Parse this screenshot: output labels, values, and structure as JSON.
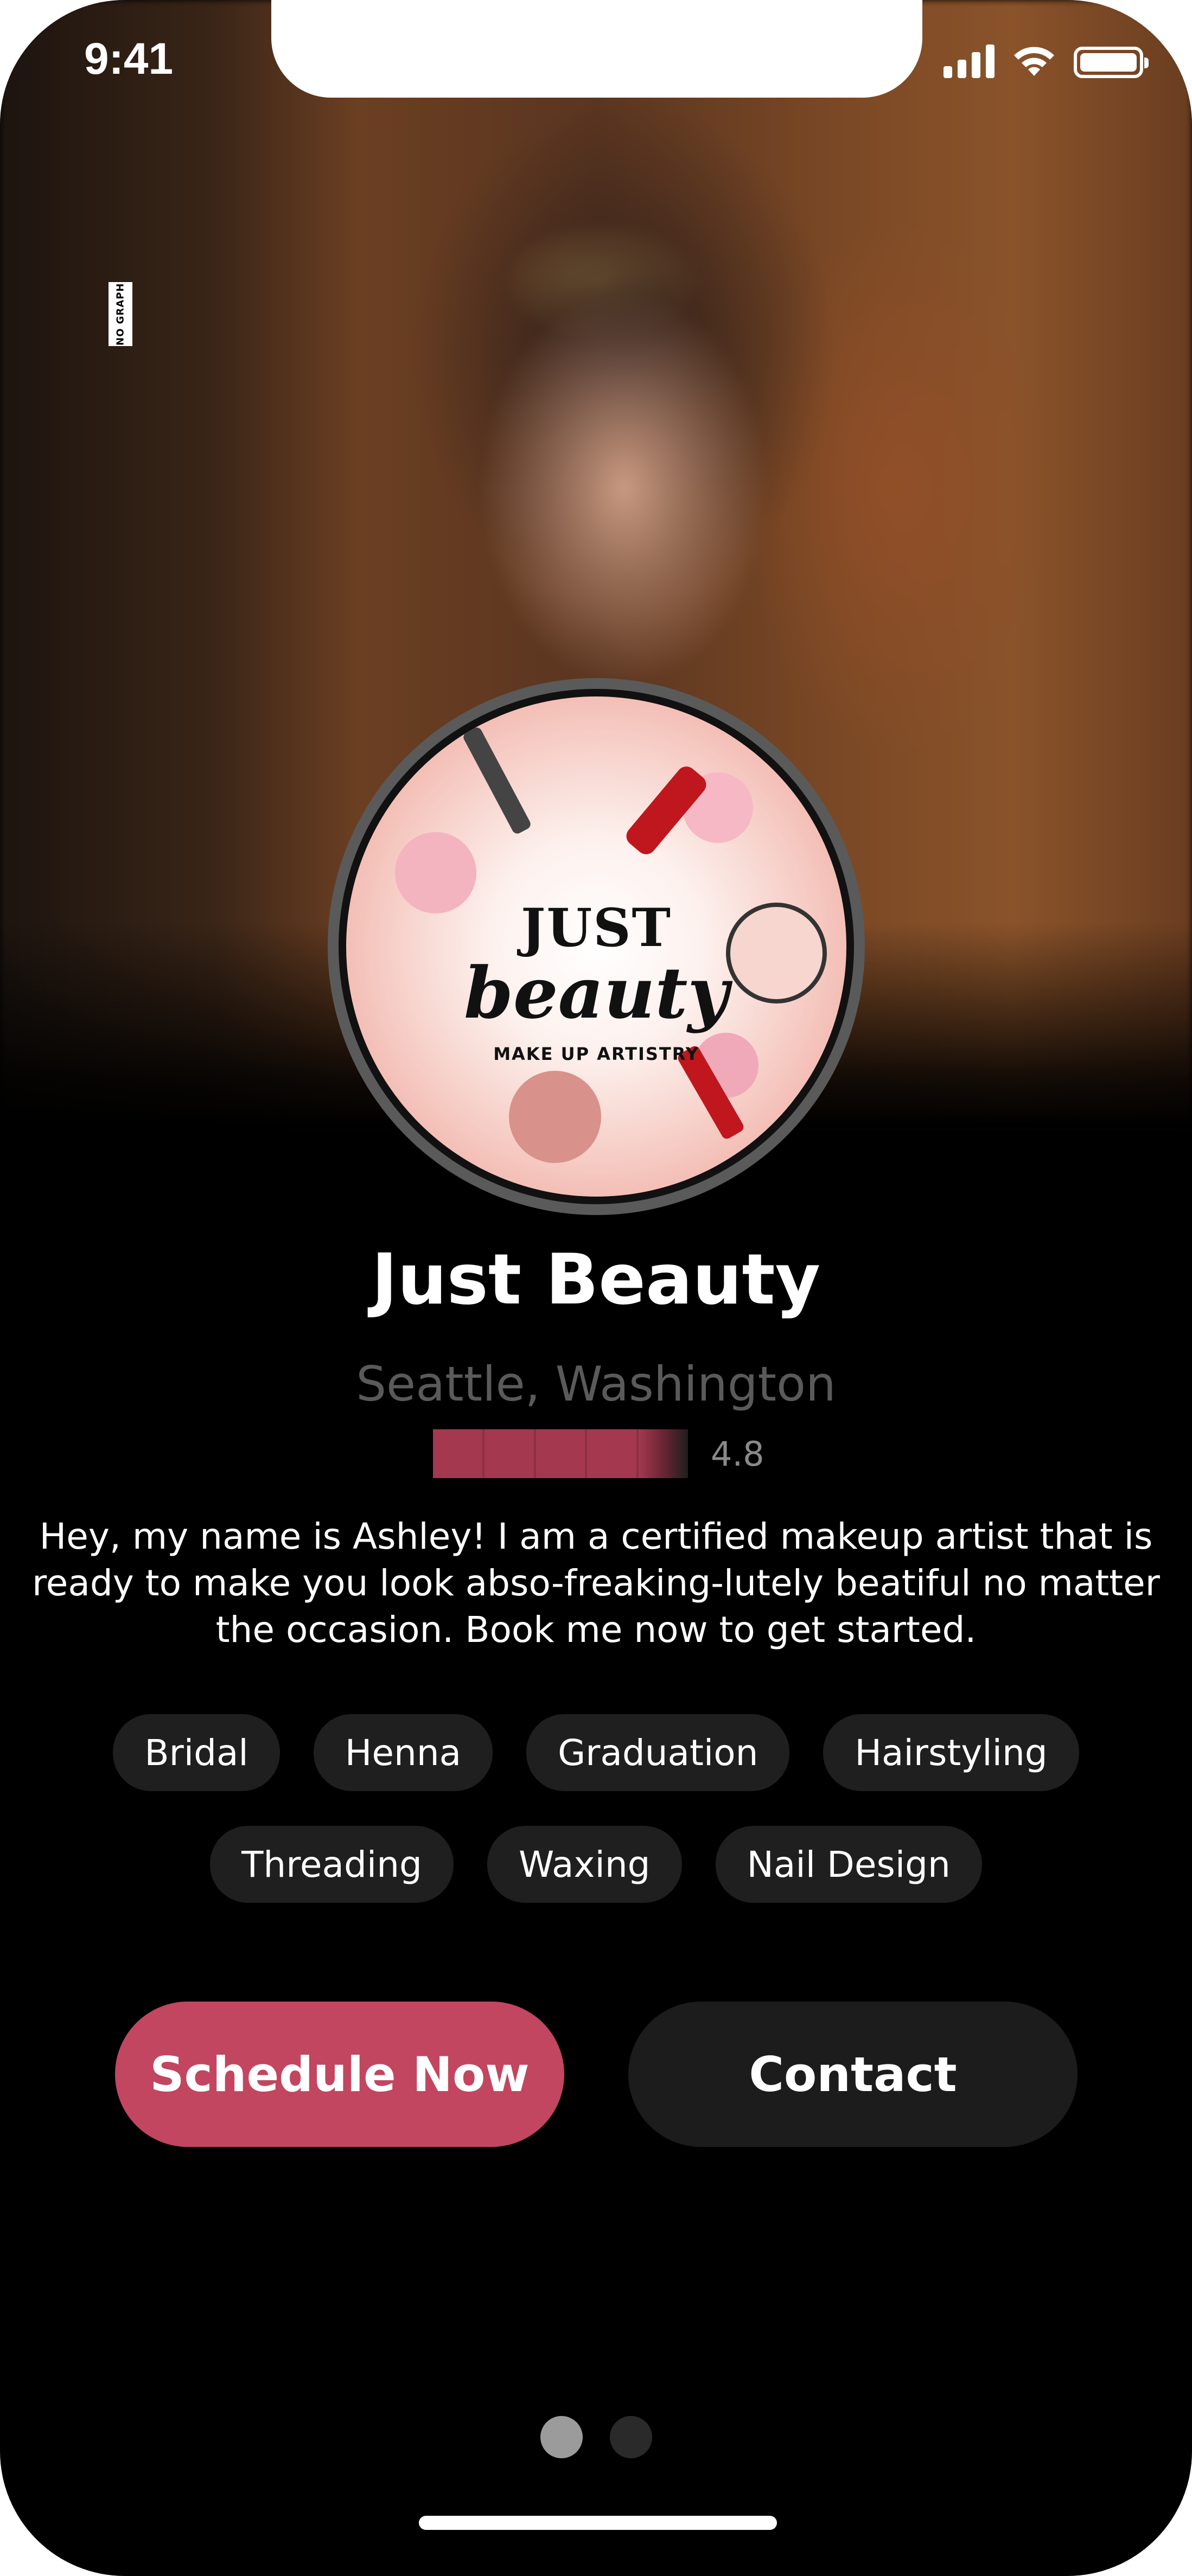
{
  "status_bar": {
    "time": "9:41"
  },
  "hero": {
    "tag_text": "NO GRAPH"
  },
  "logo": {
    "line1": "JUST",
    "line2": "beauty",
    "line3": "MAKE UP ARTISTRY"
  },
  "profile": {
    "name": "Just Beauty",
    "location": "Seattle, Washington",
    "rating_value": "4.8",
    "rating_fraction": 0.96,
    "bio": "Hey, my name is Ashley! I am a certified makeup artist that is ready to make you look abso-freaking-lutely beatiful no matter the occasion. Book me now to get started."
  },
  "services": {
    "row1": [
      "Bridal",
      "Henna",
      "Graduation",
      "Hairstyling"
    ],
    "row2": [
      "Threading",
      "Waxing",
      "Nail Design"
    ]
  },
  "actions": {
    "primary": "Schedule Now",
    "secondary": "Contact"
  },
  "pager": {
    "current": 1,
    "total": 2
  },
  "colors": {
    "accent": "#c2465f",
    "star": "#a3384f",
    "background": "#000000"
  }
}
